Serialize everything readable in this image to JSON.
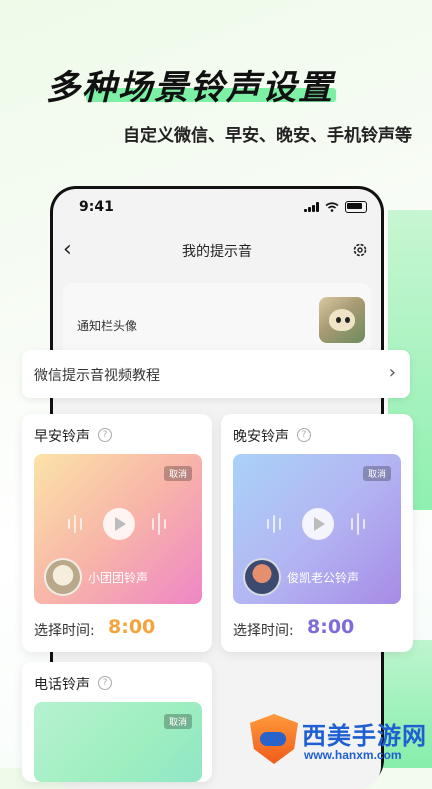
{
  "promo": {
    "headline": "多种场景铃声设置",
    "subheadline": "自定义微信、早安、晚安、手机铃声等"
  },
  "status_bar": {
    "time": "9:41"
  },
  "nav": {
    "title": "我的提示音",
    "back_icon": "chevron-left-icon",
    "settings_icon": "gear-icon"
  },
  "notification_card": {
    "label": "通知栏头像"
  },
  "tutorial": {
    "label": "微信提示音视频教程",
    "chevron": "›"
  },
  "ringtone_cards": [
    {
      "title": "早安铃声",
      "help": "?",
      "cancel": "取消",
      "ringtone_name": "小团团铃声",
      "time_label": "选择时间:",
      "time_value": "8:00",
      "time_color": "#f5a33c"
    },
    {
      "title": "晚安铃声",
      "help": "?",
      "cancel": "取消",
      "ringtone_name": "俊凯老公铃声",
      "time_label": "选择时间:",
      "time_value": "8:00",
      "time_color": "#7f6ad8"
    },
    {
      "title": "电话铃声",
      "help": "?",
      "cancel": "取消"
    }
  ],
  "watermark": {
    "text": "西美手游网",
    "url": "www.hanxm.com"
  }
}
